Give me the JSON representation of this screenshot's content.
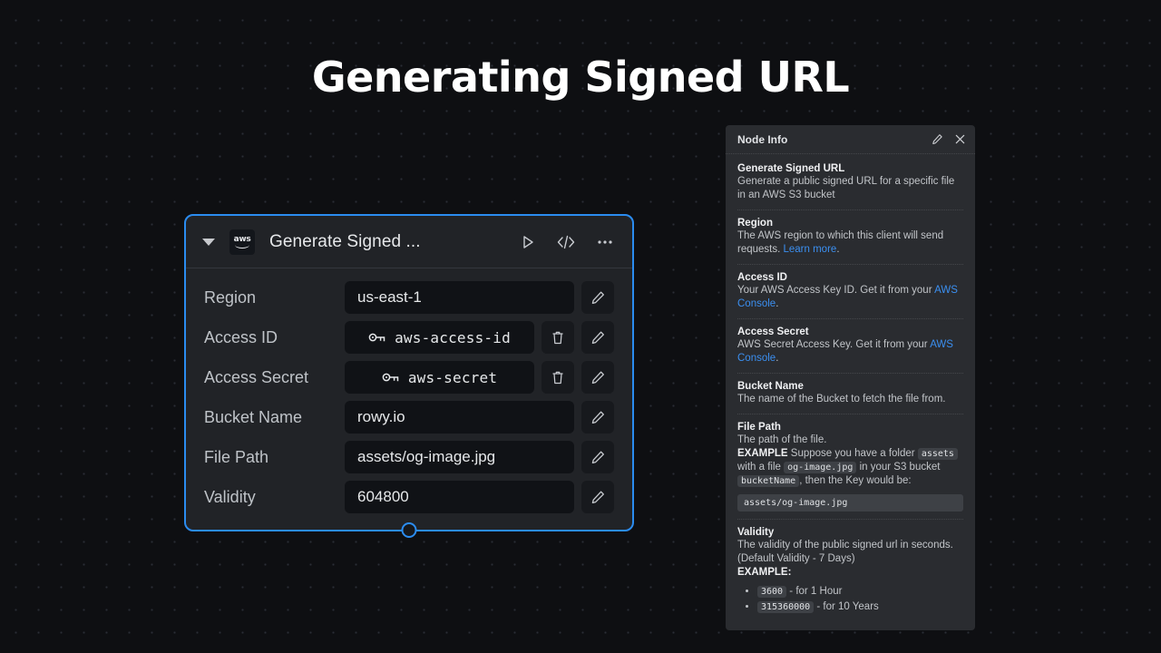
{
  "page": {
    "title": "Generating Signed URL"
  },
  "node": {
    "title": "Generate Signed ...",
    "logo_alt": "aws",
    "icons": {
      "collapse": "caret-down-icon",
      "run": "play-icon",
      "code": "code-brackets-icon",
      "more": "more-options-icon"
    },
    "fields": [
      {
        "label": "Region",
        "value": "us-east-1",
        "secret": false,
        "deletable": false
      },
      {
        "label": "Access ID",
        "value": "aws-access-id",
        "secret": true,
        "deletable": true
      },
      {
        "label": "Access Secret",
        "value": "aws-secret",
        "secret": true,
        "deletable": true
      },
      {
        "label": "Bucket Name",
        "value": "rowy.io",
        "secret": false,
        "deletable": false
      },
      {
        "label": "File Path",
        "value": "assets/og-image.jpg",
        "secret": false,
        "deletable": false
      },
      {
        "label": "Validity",
        "value": "604800",
        "secret": false,
        "deletable": false
      }
    ]
  },
  "panel": {
    "title": "Node Info",
    "edit_icon": "pencil-icon",
    "close_icon": "close-icon",
    "sections": {
      "overview": {
        "title": "Generate Signed URL",
        "text": "Generate a public signed URL for a specific file in an AWS S3 bucket"
      },
      "region": {
        "title": "Region",
        "text_before": "The AWS region to which this client will send requests. ",
        "link": "Learn more",
        "text_after": "."
      },
      "access_id": {
        "title": "Access ID",
        "text_before": "Your AWS Access Key ID. Get it from your ",
        "link": "AWS Console",
        "text_after": "."
      },
      "access_secret": {
        "title": "Access Secret",
        "text_before": "AWS Secret Access Key. Get it from your ",
        "link": "AWS Console",
        "text_after": "."
      },
      "bucket_name": {
        "title": "Bucket Name",
        "text": "The name of the Bucket to fetch the file from."
      },
      "file_path": {
        "title": "File Path",
        "text": "The path of the file.",
        "example_label": "EXAMPLE",
        "ex_part1": " Suppose you have a folder ",
        "ex_code1": "assets",
        "ex_part2": " with a file ",
        "ex_code2": "og-image.jpg",
        "ex_part3": " in your S3 bucket ",
        "ex_code3": "bucketName",
        "ex_part4": ", then the Key would be:",
        "result_code": "assets/og-image.jpg"
      },
      "validity": {
        "title": "Validity",
        "text": "The validity of the public signed url in seconds. (Default Validity - 7 Days)",
        "example_label": "EXAMPLE:",
        "items": [
          {
            "code": "3600",
            "text": " - for 1 Hour"
          },
          {
            "code": "315360000",
            "text": " - for 10 Years"
          }
        ]
      }
    }
  },
  "colors": {
    "background": "#0e0f12",
    "node_body": "#212327",
    "node_border_selected": "#2b8cf0",
    "input_bg": "#101216",
    "panel_bg": "#2a2c30",
    "link": "#3b8ff0",
    "code_bg": "#3e4146"
  }
}
